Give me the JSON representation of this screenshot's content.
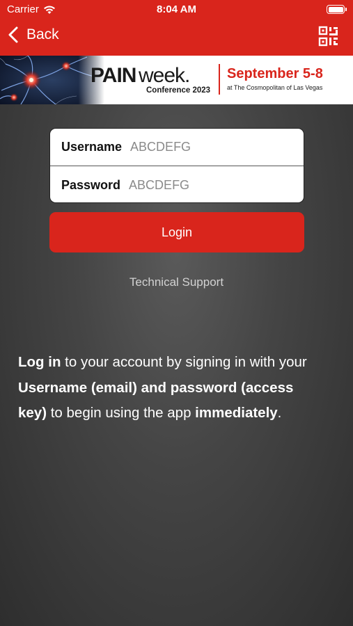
{
  "status_bar": {
    "carrier": "Carrier",
    "time": "8:04 AM",
    "icons": [
      "wifi-icon",
      "battery-icon"
    ]
  },
  "nav": {
    "back_label": "Back",
    "back_icon": "chevron-left-icon",
    "qr_icon": "qr-code-icon"
  },
  "banner": {
    "brand_pain": "PAIN",
    "brand_week": "week.",
    "conference": "Conference 2023",
    "dates": "September 5-8",
    "venue": "at The Cosmopolitan of Las Vegas"
  },
  "form": {
    "username_label": "Username",
    "username_placeholder": "ABCDEFG",
    "password_label": "Password",
    "password_placeholder": "ABCDEFG"
  },
  "login_label": "Login",
  "support_label": "Technical Support",
  "info": {
    "p1_bold": "Log in",
    "p1_text": " to your account by signing in with your ",
    "p2_bold": "Username (email) and password (access key)",
    "p2_text": " to begin using the app ",
    "p3_bold": "immediately",
    "p3_text": "."
  },
  "colors": {
    "accent": "#d9251c",
    "background": "#3a3a3a"
  }
}
